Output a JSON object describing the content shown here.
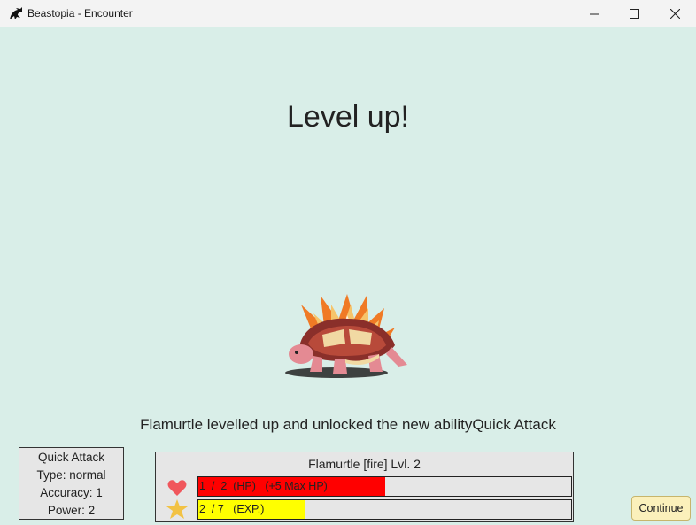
{
  "window": {
    "title": "Beastopia - Encounter",
    "icon": "dragon-icon",
    "controls": [
      "minimize-icon",
      "maximize-icon",
      "close-icon"
    ]
  },
  "screen": {
    "heading": "Level up!",
    "message": "Flamurtle levelled up and unlocked the new abilityQuick Attack"
  },
  "ability": {
    "name": "Quick Attack",
    "type": "Type: normal",
    "accuracy": "Accuracy: 1",
    "power": "Power: 2"
  },
  "beast": {
    "label": "Flamurtle [fire] Lvl. 2",
    "hp": {
      "text": "1  /  2  (HP)   (+5 Max HP)",
      "fraction": 0.5,
      "color": "#ff0000",
      "icon": "heart-icon"
    },
    "exp": {
      "text": "2  / 7   (EXP.)",
      "fraction": 0.286,
      "color": "#ffff00",
      "icon": "star-icon"
    }
  },
  "actions": {
    "continue_label": "Continue"
  },
  "colors": {
    "background": "#d9eee8",
    "panel": "#e6e6e6",
    "button": "#fbf0bb"
  }
}
